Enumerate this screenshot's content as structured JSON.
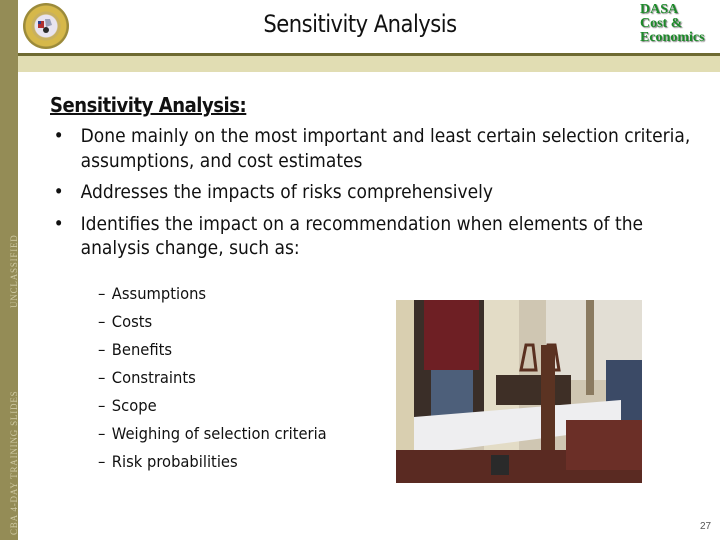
{
  "header": {
    "title": "Sensitivity Analysis",
    "logo_left": "us-army-seal",
    "logo_right_lines": [
      "DASA",
      "Cost &",
      "Economics"
    ]
  },
  "sidebar": {
    "classification": "UNCLASSIFIED",
    "course_label": "CBA 4-DAY TRAINING SLIDES"
  },
  "content": {
    "heading": "Sensitivity Analysis:",
    "bullets": [
      "Done mainly on the most important and least certain selection criteria, assumptions, and cost estimates",
      "Addresses the impacts of risks comprehensively",
      "Identifies the impact on a recommendation when elements of the analysis change, such as:"
    ],
    "sub_items": [
      "Assumptions",
      "Costs",
      "Benefits",
      "Constraints",
      "Scope",
      "Weighing of selection criteria",
      "Risk probabilities"
    ],
    "bullet_glyph": "•",
    "dash_glyph": "–",
    "photo_description": "concrete beam load test in laboratory"
  },
  "footer": {
    "page_number": "27"
  },
  "colors": {
    "sidebar": "#948c56",
    "header_rule": "#6e6a32",
    "header_band": "#e1ddb3",
    "logo_green": "#1d8a2a"
  }
}
